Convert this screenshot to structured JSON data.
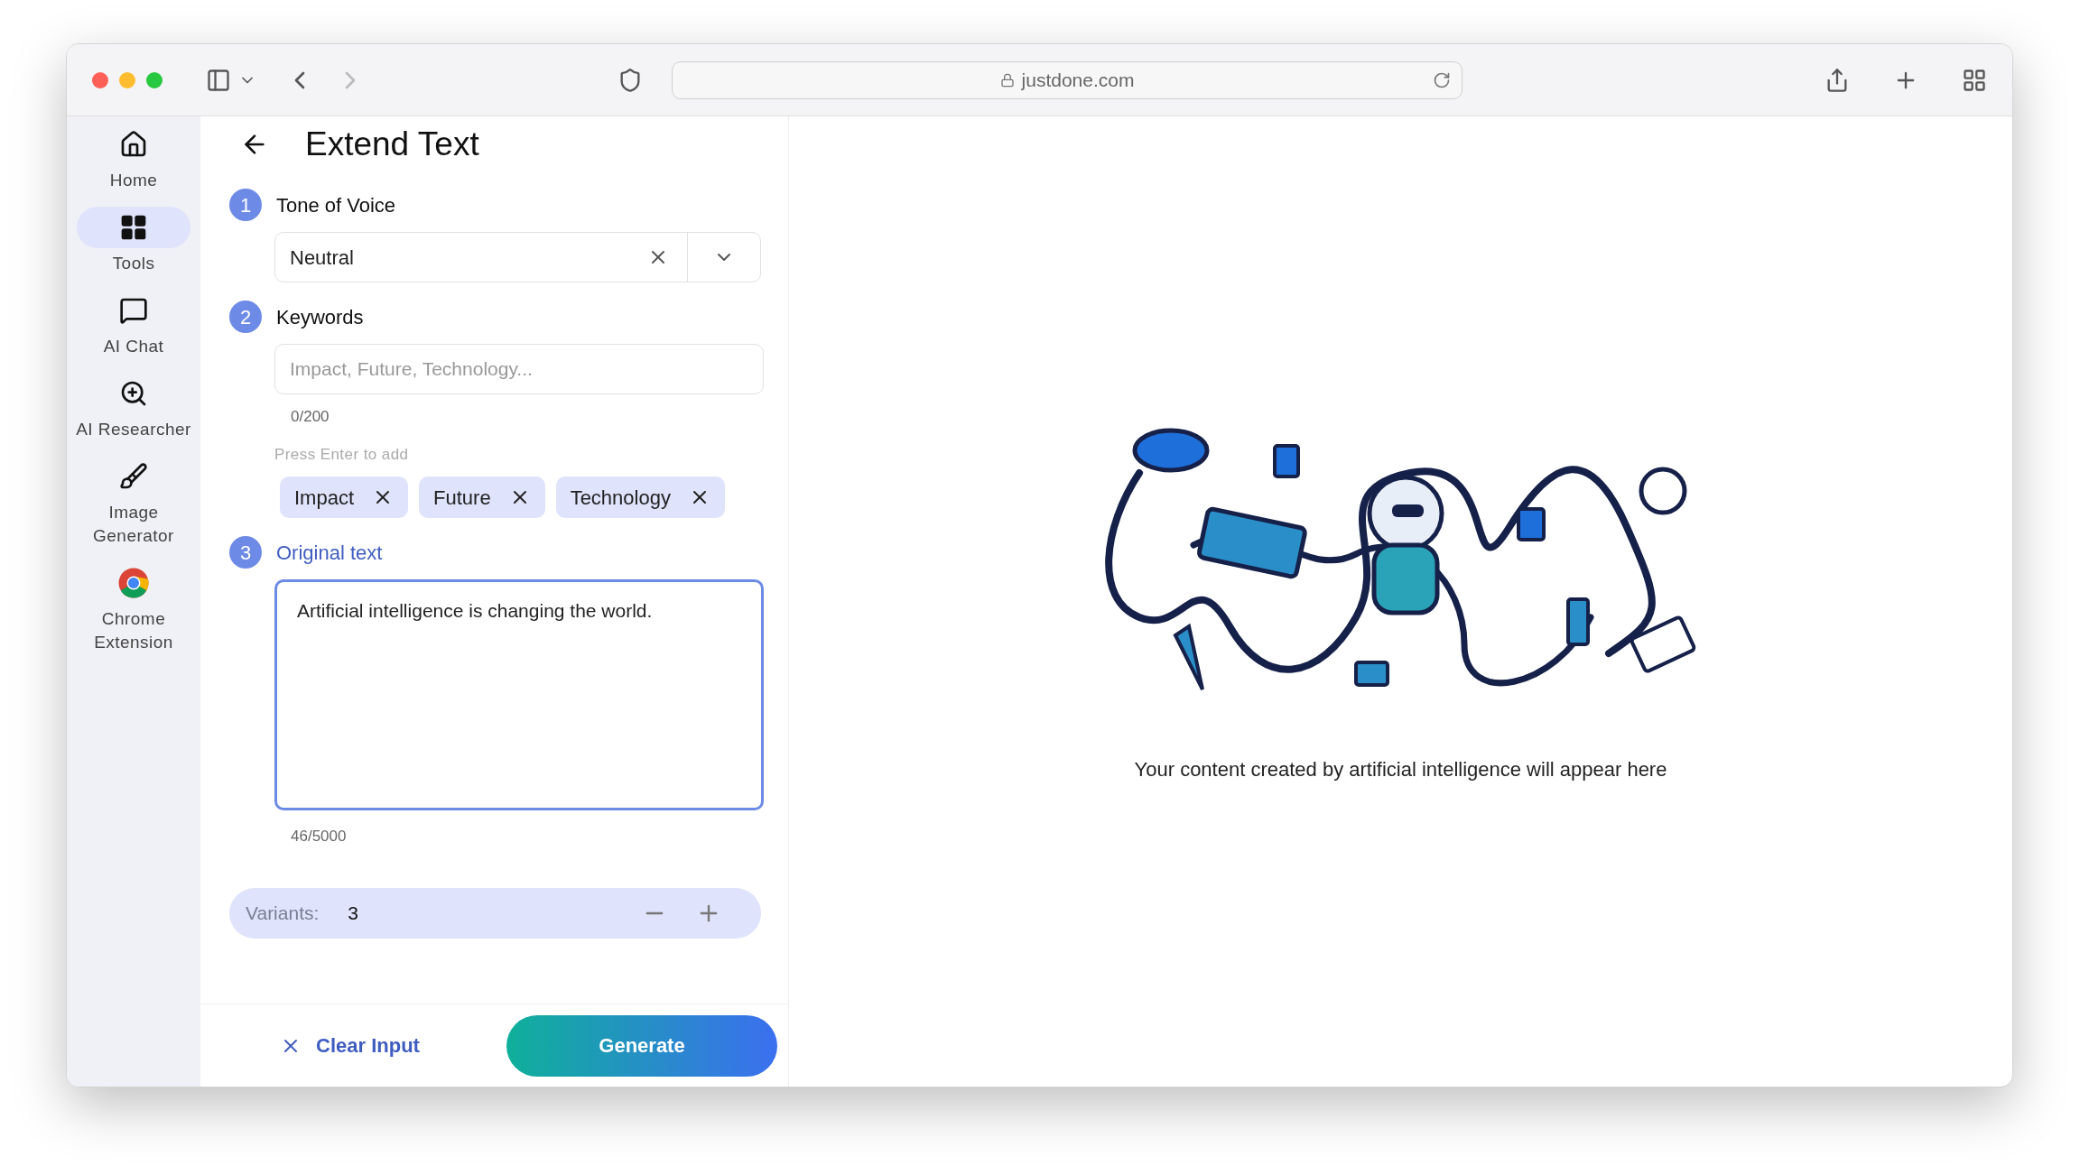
{
  "browser": {
    "url": "justdone.com"
  },
  "sidebar": {
    "items": [
      {
        "kind": "home",
        "label": "Home",
        "selected": false
      },
      {
        "kind": "tools",
        "label": "Tools",
        "selected": true
      },
      {
        "kind": "chat",
        "label": "AI Chat",
        "selected": false
      },
      {
        "kind": "research",
        "label": "AI Researcher",
        "selected": false
      },
      {
        "kind": "brush",
        "label": "Image Generator",
        "selected": false
      },
      {
        "kind": "chrome",
        "label": "Chrome Extension",
        "selected": false
      }
    ]
  },
  "page": {
    "title": "Extend Text"
  },
  "tone": {
    "number": "1",
    "label": "Tone of Voice",
    "value": "Neutral"
  },
  "keywords": {
    "number": "2",
    "label": "Keywords",
    "placeholder": "Impact, Future, Technology...",
    "counter": "0/200",
    "hint": "Press Enter to add",
    "tags": [
      "Impact",
      "Future",
      "Technology"
    ]
  },
  "original": {
    "number": "3",
    "label": "Original text",
    "focused": true,
    "value": "Artificial intelligence is changing the world.",
    "counter": "46/5000"
  },
  "variants": {
    "label": "Variants:",
    "value": "3"
  },
  "footer": {
    "clear": "Clear Input",
    "generate": "Generate"
  },
  "output": {
    "message": "Your content created by artificial intelligence will appear here"
  }
}
